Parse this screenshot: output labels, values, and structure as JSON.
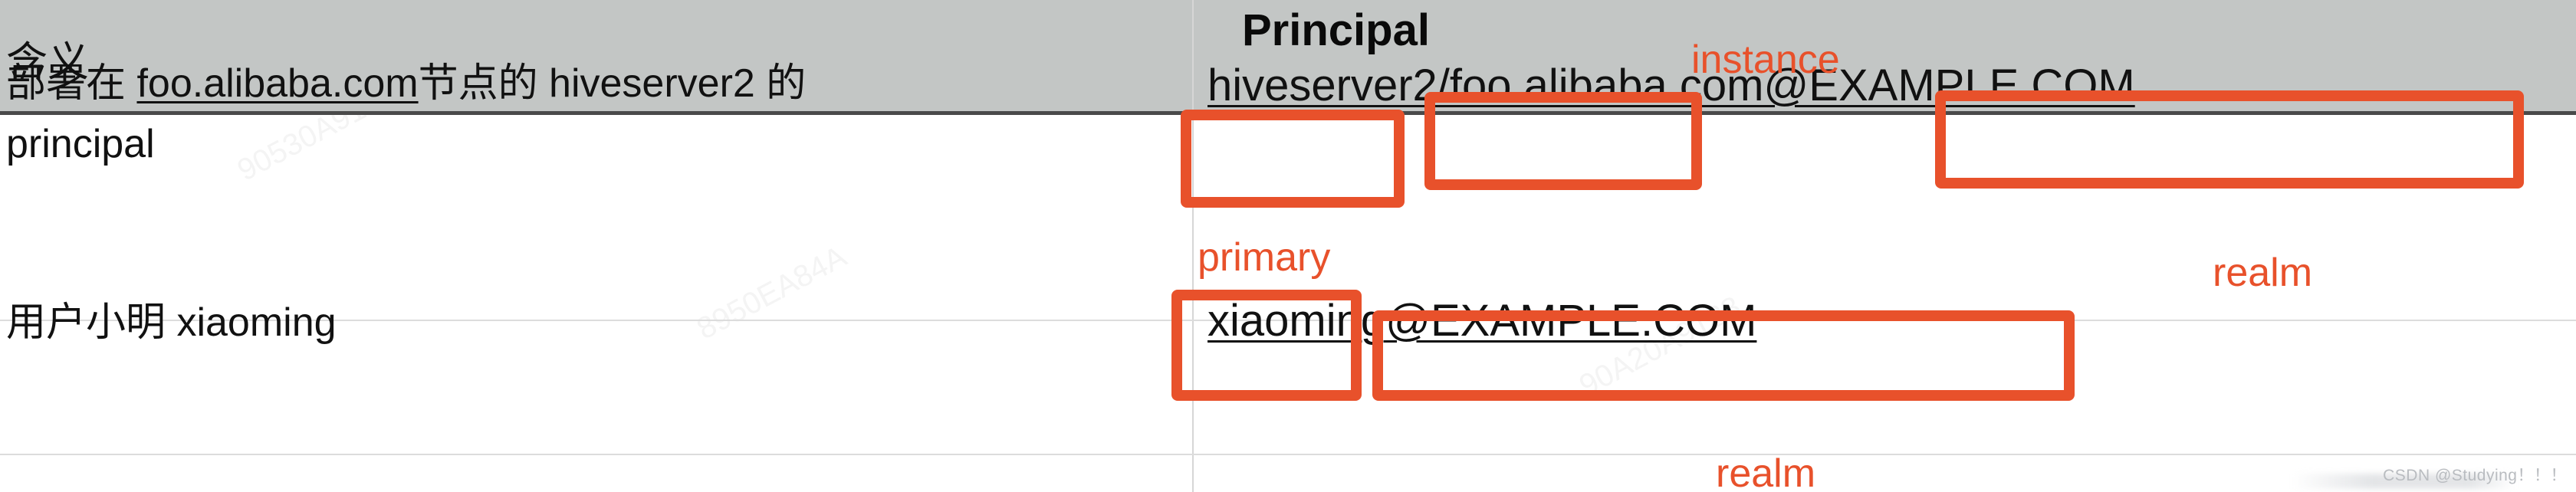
{
  "table": {
    "columns": [
      {
        "label": "含义"
      },
      {
        "label": "Principal"
      }
    ],
    "rows": [
      {
        "meaning_line1_prefix": "部署在 ",
        "meaning_link": "foo.alibaba.com",
        "meaning_line1_suffix": "节点的 hiveserver2 的",
        "meaning_line2": "principal",
        "principal": "hiveserver2/foo.alibaba.com@EXAMPLE.COM"
      },
      {
        "meaning_line1_prefix": "用户小明 xiaoming",
        "meaning_link": "",
        "meaning_line1_suffix": "",
        "meaning_line2": "",
        "principal": "xiaoming@EXAMPLE.COM"
      }
    ]
  },
  "annotations": {
    "accent_color": "#e8512b",
    "labels": [
      {
        "id": "instance",
        "text": "instance"
      },
      {
        "id": "primary",
        "text": "primary"
      },
      {
        "id": "realm-1",
        "text": "realm"
      },
      {
        "id": "realm-2",
        "text": "realm"
      }
    ],
    "boxes": [
      {
        "id": "primary-row1",
        "covers": "hiveserver2"
      },
      {
        "id": "instance-row1",
        "covers": "foo.alibaba.com"
      },
      {
        "id": "realm-row1",
        "covers": "EXAMPLE.COM"
      },
      {
        "id": "primary-row2",
        "covers": "xiaoming"
      },
      {
        "id": "realm-row2",
        "covers": "EXAMPLE.COM"
      }
    ]
  },
  "watermark": {
    "text": "CSDN @Studying！！！"
  },
  "header_colors": {
    "header_background": "#c3c6c5",
    "header_rule": "#4a4a4a",
    "row_rule": "#dcdcdc",
    "text": "#111111"
  }
}
